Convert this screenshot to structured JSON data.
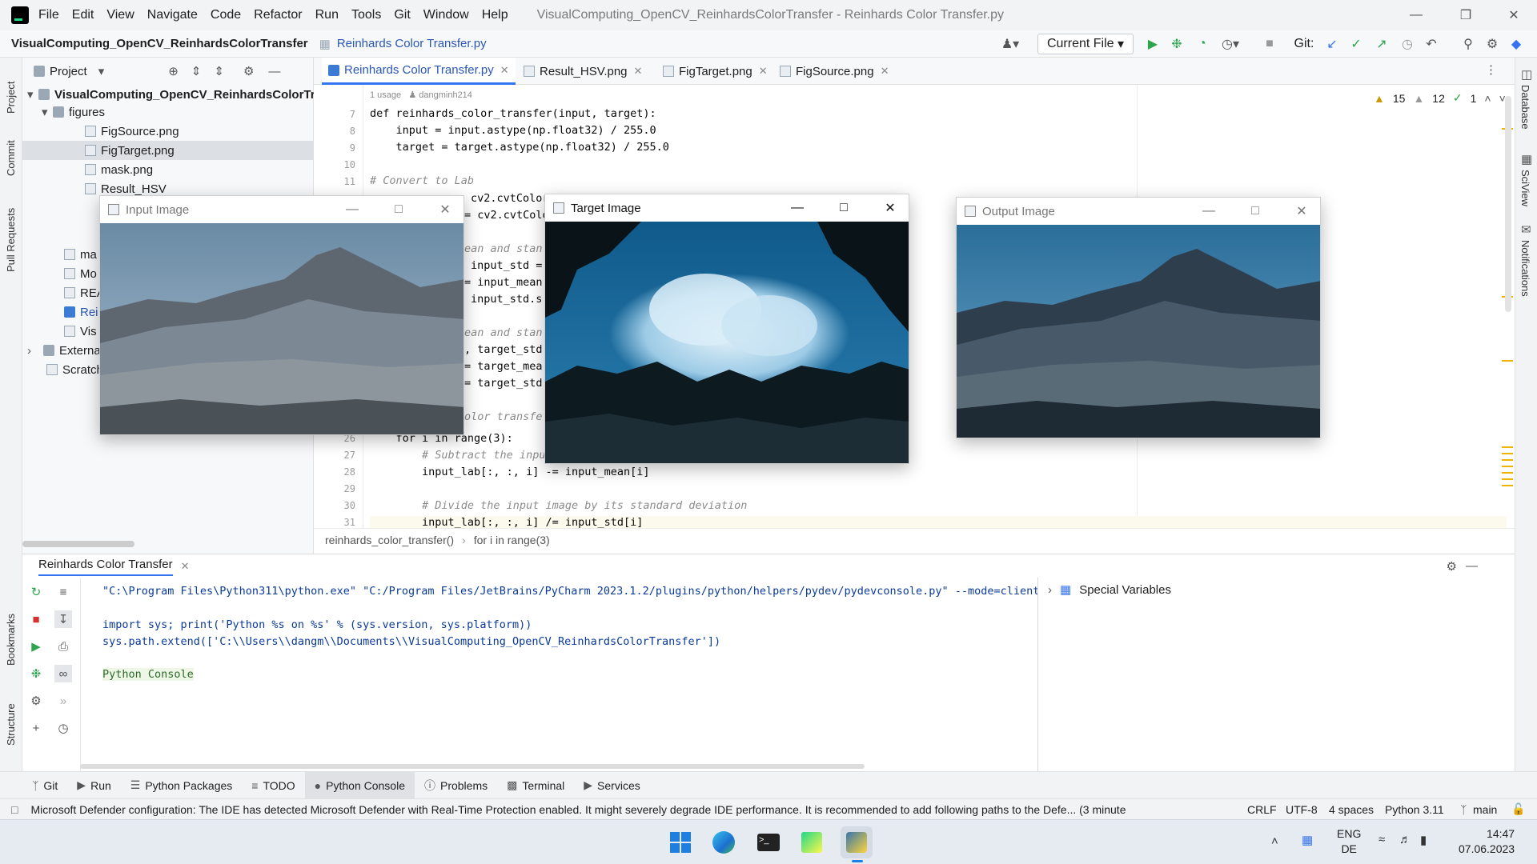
{
  "window": {
    "title": "VisualComputing_OpenCV_ReinhardsColorTransfer - Reinhards Color Transfer.py",
    "menu": [
      "File",
      "Edit",
      "View",
      "Navigate",
      "Code",
      "Refactor",
      "Run",
      "Tools",
      "Git",
      "Window",
      "Help"
    ]
  },
  "navbar": {
    "project": "VisualComputing_OpenCV_ReinhardsColorTransfer",
    "file": "Reinhards Color Transfer.py",
    "run_config": "Current File",
    "git_label": "Git:"
  },
  "left_strip": [
    "Project",
    "Commit",
    "Pull Requests",
    "Bookmarks",
    "Structure"
  ],
  "right_strip": [
    "Database",
    "SciView",
    "Notifications"
  ],
  "project_panel": {
    "header": "Project",
    "root": "VisualComputing_OpenCV_ReinhardsColorTr",
    "folder": "figures",
    "files": [
      "FigSource.png",
      "FigTarget.png",
      "mask.png",
      "Result_HSV"
    ],
    "items_partial": [
      "ma",
      "Mo",
      "REA",
      "Rei",
      "Vis"
    ],
    "external": "Externa",
    "scratch": "Scratch"
  },
  "tabs": [
    "Reinhards Color Transfer.py",
    "Result_HSV.png",
    "FigTarget.png",
    "FigSource.png"
  ],
  "editor": {
    "usage_hint": "1 usage",
    "author_hint": "dangminh214",
    "inspections": {
      "warnings": "15",
      "weak": "12",
      "ok": "1"
    },
    "lines": [
      {
        "n": "7",
        "text": "def reinhards_color_transfer(input, target):"
      },
      {
        "n": "8",
        "text": "    input = input.astype(np.float32) / 255.0"
      },
      {
        "n": "9",
        "text": "    target = target.astype(np.float32) / 255.0"
      },
      {
        "n": "10",
        "text": ""
      },
      {
        "n": "11",
        "text": "# Convert to Lab"
      },
      {
        "n": "26",
        "text": "    for i in range(3):"
      },
      {
        "n": "27",
        "text": "        # Subtract the input"
      },
      {
        "n": "28",
        "text": "        input_lab[:, :, i] -= input_mean[i]"
      },
      {
        "n": "29",
        "text": ""
      },
      {
        "n": "30",
        "text": "        # Divide the input image by its standard deviation"
      },
      {
        "n": "31",
        "text": "        input_lab[:, :, i] /= input_std[i]"
      }
    ],
    "fragments": [
      "cv2.cvtColor",
      "= cv2.cvtColo",
      "ean and stan",
      "input_std =",
      "= input_mean",
      "input_std.s",
      "ean and stan",
      ", target_std",
      "= target_mea",
      "= target_std",
      "olor transfe"
    ],
    "breadcrumb": [
      "reinhards_color_transfer()",
      "for i in range(3)"
    ]
  },
  "console": {
    "tab": "Reinhards Color Transfer",
    "lines": [
      "\"C:\\Program Files\\Python311\\python.exe\" \"C:/Program Files/JetBrains/PyCharm 2023.1.2/plugins/python/helpers/pydev/pydevconsole.py\" --mode=client --hc",
      "import sys; print('Python %s on %s' % (sys.version, sys.platform))",
      "sys.path.extend(['C:\\\\Users\\\\dangm\\\\Documents\\\\VisualComputing_OpenCV_ReinhardsColorTransfer'])",
      "Python Console"
    ],
    "variables": "Special Variables"
  },
  "tool_tabs": [
    "Git",
    "Run",
    "Python Packages",
    "TODO",
    "Python Console",
    "Problems",
    "Terminal",
    "Services"
  ],
  "status": {
    "message": "Microsoft Defender configuration: The IDE has detected Microsoft Defender with Real-Time Protection enabled. It might severely degrade IDE performance. It is recommended to add following paths to the Defe... (3 minute",
    "line_sep": "CRLF",
    "encoding": "UTF-8",
    "indent": "4 spaces",
    "interpreter": "Python 3.11",
    "branch": "main"
  },
  "windows": {
    "input": "Input Image",
    "target": "Target Image",
    "output": "Output Image"
  },
  "taskbar": {
    "lang": "ENG",
    "layout": "DE",
    "time": "14:47",
    "date": "07.06.2023"
  }
}
